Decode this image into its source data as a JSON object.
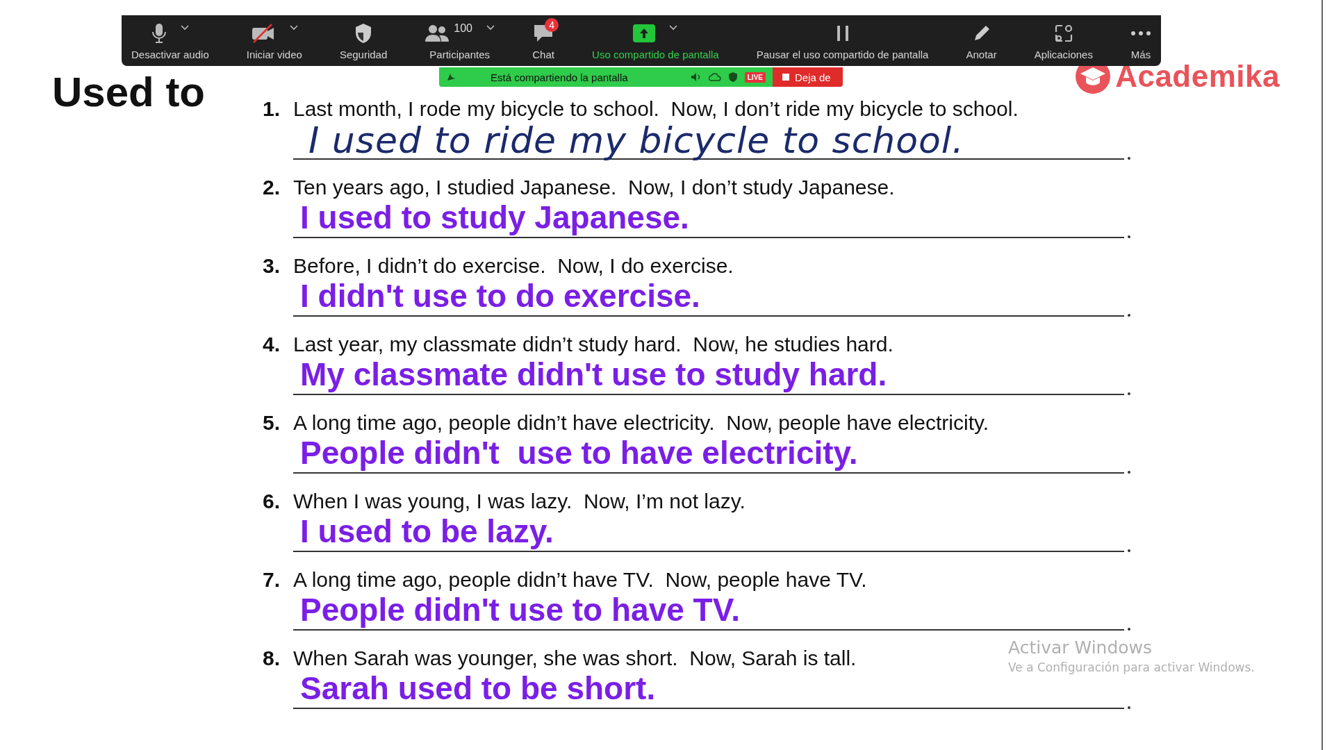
{
  "toolbar": {
    "items": [
      {
        "kind": "mic",
        "label": "Desactivar audio",
        "caret": true,
        "highlighted": false
      },
      {
        "kind": "video-off",
        "label": "Iniciar video",
        "caret": true,
        "highlighted": false
      },
      {
        "kind": "shield",
        "label": "Seguridad",
        "caret": false,
        "highlighted": false
      },
      {
        "kind": "people",
        "label": "Participantes",
        "caret": true,
        "highlighted": false,
        "count": "100"
      },
      {
        "kind": "chat",
        "label": "Chat",
        "caret": false,
        "highlighted": false,
        "badge": "4"
      },
      {
        "kind": "share",
        "label": "Uso compartido de pantalla",
        "caret": true,
        "highlighted": true
      },
      {
        "kind": "pause",
        "label": "Pausar el uso compartido de pantalla",
        "caret": false,
        "highlighted": false
      },
      {
        "kind": "pen",
        "label": "Anotar",
        "caret": false,
        "highlighted": false
      },
      {
        "kind": "apps",
        "label": "Aplicaciones",
        "caret": false,
        "highlighted": false
      },
      {
        "kind": "more",
        "label": "Más",
        "caret": false,
        "highlighted": false
      }
    ]
  },
  "share_bar": {
    "message": "Está compartiendo la pantalla",
    "live": "LIVE",
    "stop_button": "Deja de"
  },
  "slide": {
    "title": "Used to",
    "logo": "Academika",
    "questions": [
      {
        "number": "1.",
        "prompt": "Last month, I rode my bicycle to school.  Now, I don’t ride my bicycle to school.",
        "answer": "I used to ride my bicycle to school.",
        "kind": "handwritten"
      },
      {
        "number": "2.",
        "prompt": "Ten years ago, I studied Japanese.  Now, I don’t study Japanese.",
        "answer": "I used to study Japanese.",
        "kind": "typed"
      },
      {
        "number": "3.",
        "prompt": "Before, I didn’t do exercise.  Now, I do exercise.",
        "answer": "I didn't use to do exercise.",
        "kind": "typed"
      },
      {
        "number": "4.",
        "prompt": "Last year, my classmate didn’t study hard.  Now, he studies hard.",
        "answer": "My classmate didn't use to study hard.",
        "kind": "typed"
      },
      {
        "number": "5.",
        "prompt": "A long time ago, people didn’t have electricity.  Now, people have electricity.",
        "answer": "People didn't  use to have electricity.",
        "kind": "typed"
      },
      {
        "number": "6.",
        "prompt": "When I was young, I was lazy.  Now, I’m not lazy.",
        "answer": "I used to be lazy.",
        "kind": "typed"
      },
      {
        "number": "7.",
        "prompt": "A long time ago, people didn’t have TV.  Now, people have TV.",
        "answer": "People didn't use to have TV.",
        "kind": "typed"
      },
      {
        "number": "8.",
        "prompt": "When Sarah was younger, she was short.  Now, Sarah is tall.",
        "answer": "Sarah used to be short.",
        "kind": "typed"
      }
    ]
  },
  "windows_activation": {
    "title": "Activar Windows",
    "subtitle": "Ve a Configuración para activar Windows."
  }
}
